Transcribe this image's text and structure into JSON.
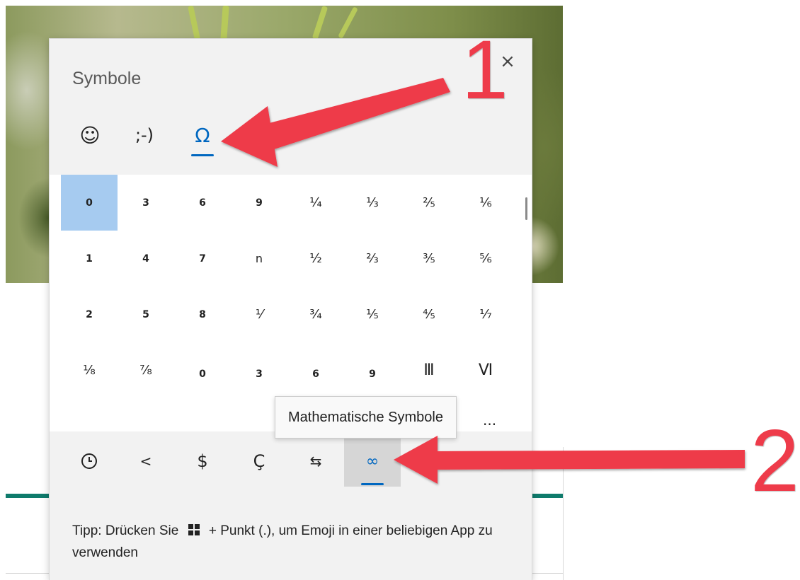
{
  "panel": {
    "title": "Symbole",
    "close": "×"
  },
  "tabs": [
    {
      "label": "☺",
      "icon": "smiley-icon"
    },
    {
      "label": ";-)",
      "icon": "kaomoji-icon"
    },
    {
      "label": "Ω",
      "icon": "omega-icon"
    }
  ],
  "grid": [
    [
      "0",
      "3",
      "6",
      "9",
      "¼",
      "⅓",
      "⅖",
      "⅙"
    ],
    [
      "1",
      "4",
      "7",
      "n",
      "½",
      "⅔",
      "⅗",
      "⅚"
    ],
    [
      "2",
      "5",
      "8",
      "⅟",
      "¾",
      "⅕",
      "⅘",
      "⅐"
    ],
    [
      "⅛",
      "⅞",
      "0",
      "3",
      "6",
      "9",
      "Ⅲ",
      "Ⅵ"
    ]
  ],
  "categories": [
    {
      "label": "🕒",
      "icon": "clock-icon"
    },
    {
      "label": "<",
      "icon": "punctuation-icon"
    },
    {
      "label": "$",
      "icon": "currency-icon"
    },
    {
      "label": "Ç",
      "icon": "latin-icon"
    },
    {
      "label": "⇆",
      "icon": "arrows-icon"
    },
    {
      "label": "∞",
      "icon": "infinity-icon"
    },
    {
      "label": "",
      "icon": "language-icon"
    }
  ],
  "tooltip": "Mathematische Symbole",
  "tooltip_overflow": "...",
  "tip": {
    "prefix": "Tipp: Drücken Sie",
    "suffix": "+ Punkt (.), um Emoji in einer beliebigen App zu verwenden"
  },
  "annotations": {
    "one": "1",
    "two": "2"
  },
  "colors": {
    "accent": "#0067c0",
    "selected": "#a6cbf0",
    "annotation": "#ee3b4a"
  }
}
